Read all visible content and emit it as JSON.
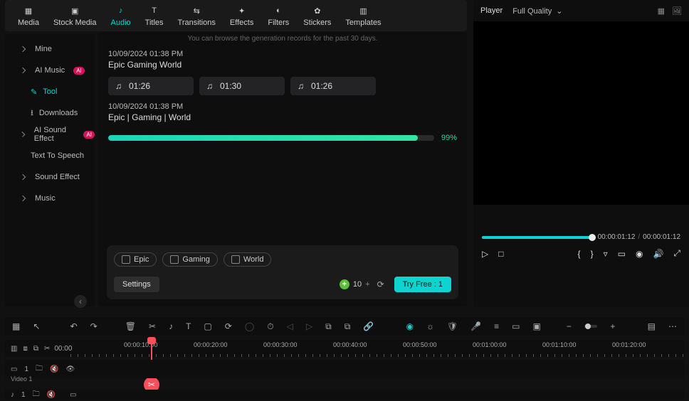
{
  "tabs": {
    "media": "Media",
    "stock": "Stock Media",
    "audio": "Audio",
    "titles": "Titles",
    "transitions": "Transitions",
    "effects": "Effects",
    "filters": "Filters",
    "stickers": "Stickers",
    "templates": "Templates",
    "active": "audio"
  },
  "sidebar": {
    "mine": "Mine",
    "ai_music": "AI Music",
    "tool": "Tool",
    "downloads": "Downloads",
    "ai_sound_effect": "AI Sound Effect",
    "tts": "Text To Speech",
    "sound_effect": "Sound Effect",
    "music": "Music"
  },
  "main": {
    "hint": "You can browse the generation records for the past 30 days.",
    "b1_date": "10/09/2024 01:38 PM",
    "b1_title": "Epic Gaming World",
    "b1_clip1": "01:26",
    "b1_clip2": "01:30",
    "b1_clip3": "01:26",
    "b2_date": "10/09/2024 01:38 PM",
    "b2_title": "Epic | Gaming | World",
    "b2_pct": "99%",
    "progress_pct": 95,
    "tags": {
      "t1": "Epic",
      "t2": "Gaming",
      "t3": "World"
    },
    "settings": "Settings",
    "coin": "10",
    "tryfree": "Try Free : 1"
  },
  "preview": {
    "player": "Player",
    "quality": "Full Quality",
    "time_cur": "00:00:01:12",
    "time_total": "00:00:01:12",
    "seek_pct": 100
  },
  "ruler": {
    "left0": "00:00",
    "marks": [
      "00:00:10:00",
      "00:00:20:00",
      "00:00:30:00",
      "00:00:40:00",
      "00:00:50:00",
      "00:01:00:00",
      "00:01:10:00",
      "00:01:20:00"
    ]
  },
  "track": {
    "video_label": "Video 1",
    "vnum": "1",
    "anum": "1"
  },
  "chart_data": {
    "type": "bar",
    "title": "AI Music generation progress",
    "categories": [
      "Epic | Gaming | World"
    ],
    "values": [
      99
    ],
    "ylim": [
      0,
      100
    ],
    "ylabel": "%"
  }
}
